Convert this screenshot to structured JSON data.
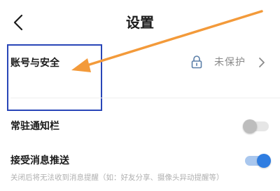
{
  "header": {
    "title": "设置",
    "back_icon": "chevron-left-icon"
  },
  "account_security": {
    "label": "账号与安全",
    "status": "未保护",
    "status_icon": "lock-icon",
    "chevron_icon": "chevron-right-icon"
  },
  "settings": {
    "pinned_notification": {
      "label": "常驻通知栏",
      "enabled": false
    },
    "push_messages": {
      "label": "接受消息推送",
      "enabled": true,
      "description": "关闭后将无法收到消息提醒（如：好友分享、摄像头异动提醒等）"
    }
  },
  "annotations": {
    "highlight_color": "#2946b8",
    "arrow_color": "#f39a3a"
  },
  "colors": {
    "toggle_on_track": "#a9c7ee",
    "toggle_on_knob": "#2f7de1",
    "toggle_off_track": "#e6e6e6",
    "toggle_off_knob": "#bdbdbd"
  }
}
